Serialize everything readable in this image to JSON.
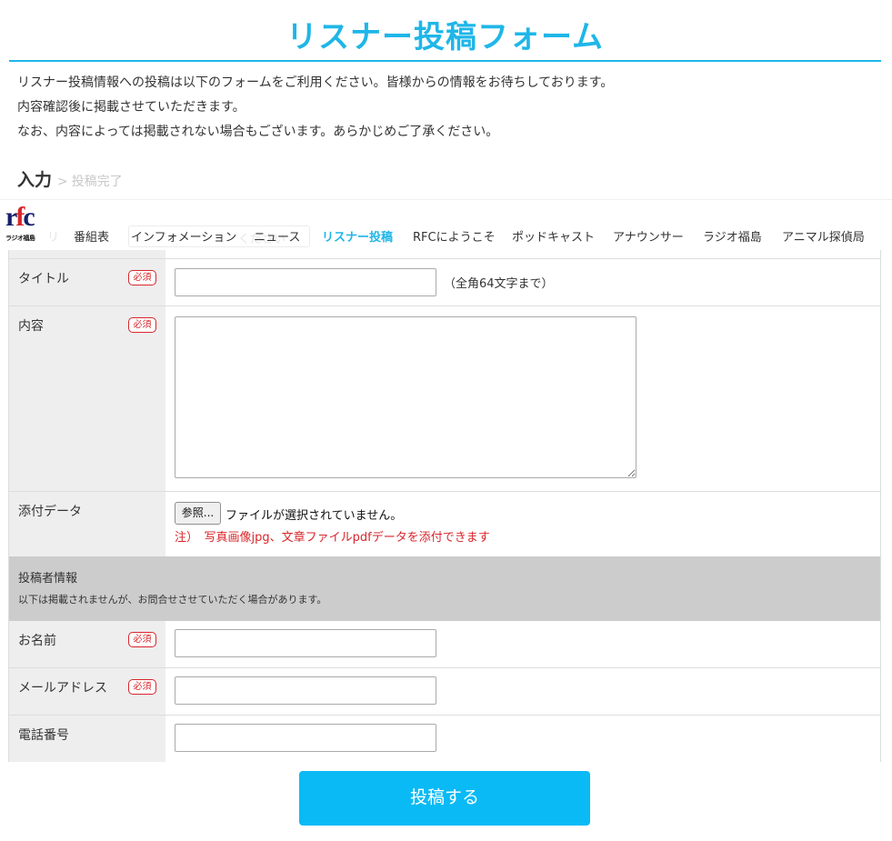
{
  "page": {
    "title": "リスナー投稿フォーム",
    "intro": [
      "リスナー投稿情報への投稿は以下のフォームをご利用ください。皆様からの情報をお待ちしております。",
      "内容確認後に掲載させていただきます。",
      "なお、内容によっては掲載されない場合もございます。あらかじめご了承ください。"
    ]
  },
  "steps": {
    "current": "入力",
    "separator": ">",
    "next": "投稿完了"
  },
  "header": {
    "logo_mark_a": "r",
    "logo_mark_b": "f",
    "logo_mark_c": "c",
    "logo_sub": "ラジオ福島",
    "nav": [
      "番組表",
      "インフォメーション",
      "ニュース",
      "リスナー投稿",
      "RFCにようこそ",
      "ポッドキャスト",
      "アナウンサー",
      "ラジオ福島",
      "アニマル探偵局"
    ],
    "active_nav": "リスナー投稿",
    "ghost_left": "リ",
    "ghost_box": "ください"
  },
  "form": {
    "required_badge": "必須",
    "title_field": {
      "label": "タイトル",
      "value": "",
      "hint": "（全角64文字まで）"
    },
    "content_field": {
      "label": "内容",
      "value": ""
    },
    "attachment_field": {
      "label": "添付データ",
      "button": "参照...",
      "status": "ファイルが選択されていません。",
      "note": "注）　写真画像jpg、文章ファイルpdfデータを添付できます"
    },
    "poster_section": {
      "title": "投稿者情報",
      "subtitle": "以下は掲載されませんが、お問合せさせていただく場合があります。"
    },
    "name_field": {
      "label": "お名前",
      "value": ""
    },
    "email_field": {
      "label": "メールアドレス",
      "value": ""
    },
    "phone_field": {
      "label": "電話番号",
      "value": ""
    },
    "submit": "投稿する"
  },
  "colors": {
    "accent": "#1fb6e8",
    "submit_bg": "#0abaf5",
    "required": "#d8262b",
    "label_bg": "#eeeeee",
    "section_bg": "#cccccc"
  }
}
